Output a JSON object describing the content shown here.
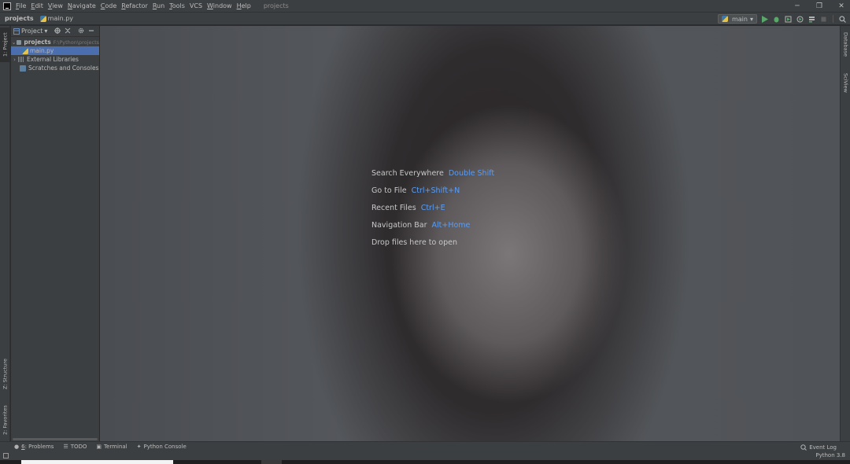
{
  "menubar": {
    "items": [
      {
        "mnemonic": "F",
        "rest": "ile"
      },
      {
        "mnemonic": "E",
        "rest": "dit"
      },
      {
        "mnemonic": "V",
        "rest": "iew"
      },
      {
        "mnemonic": "N",
        "rest": "avigate"
      },
      {
        "mnemonic": "C",
        "rest": "ode"
      },
      {
        "mnemonic": "R",
        "rest": "efactor"
      },
      {
        "mnemonic": "R",
        "rest": "un"
      },
      {
        "mnemonic": "T",
        "rest": "ools"
      },
      {
        "mnemonic": "",
        "rest": "VCS"
      },
      {
        "mnemonic": "W",
        "rest": "indow"
      },
      {
        "mnemonic": "H",
        "rest": "elp"
      }
    ],
    "window_title": "projects"
  },
  "window_controls": {
    "minimize": "─",
    "restore": "❐",
    "close": "✕"
  },
  "navbar": {
    "project": "projects",
    "file": "main.py"
  },
  "toolbar": {
    "run_config": "main",
    "run_config_arrow": "▾"
  },
  "left_stripe": {
    "project_tab": "1: Project",
    "structure_tab": "Z: Structure",
    "favorites_tab": "2: Favorites"
  },
  "right_stripe": {
    "database_tab": "Database",
    "sciview_tab": "SciView"
  },
  "project_panel": {
    "title": "Project",
    "title_arrow": "▾",
    "tree": [
      {
        "label": "projects",
        "path": "F:\\Python\\projects"
      },
      {
        "label": "main.py"
      },
      {
        "label": "External Libraries"
      },
      {
        "label": "Scratches and Consoles"
      }
    ]
  },
  "welcome": {
    "rows": [
      {
        "label": "Search Everywhere",
        "shortcut": "Double Shift"
      },
      {
        "label": "Go to File",
        "shortcut": "Ctrl+Shift+N"
      },
      {
        "label": "Recent Files",
        "shortcut": "Ctrl+E"
      },
      {
        "label": "Navigation Bar",
        "shortcut": "Alt+Home"
      },
      {
        "label": "Drop files here to open",
        "shortcut": ""
      }
    ]
  },
  "bottom_tools": {
    "problems_number": "6",
    "problems": ": Problems",
    "todo": "TODO",
    "terminal": "Terminal",
    "python_console": "Python Console",
    "event_log": "Event Log"
  },
  "statusbar": {
    "interpreter": "Python 3.8"
  },
  "colors": {
    "accent_blue": "#589df6",
    "selection": "#4b6eaf",
    "run_green": "#59a869"
  },
  "icons": [
    "pycharm-logo",
    "python-file",
    "folder",
    "library",
    "scratches",
    "run",
    "debug",
    "coverage",
    "profile",
    "build",
    "stop",
    "search",
    "gear",
    "collapse",
    "locate"
  ]
}
